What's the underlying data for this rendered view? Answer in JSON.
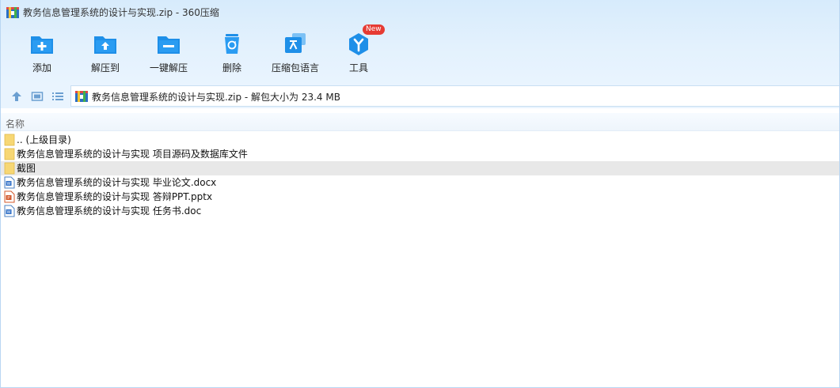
{
  "window": {
    "title": "教务信息管理系统的设计与实现.zip - 360压缩"
  },
  "toolbar": {
    "items": [
      {
        "id": "add",
        "label": "添加",
        "icon": "add-icon"
      },
      {
        "id": "extract-to",
        "label": "解压到",
        "icon": "extract-to-icon"
      },
      {
        "id": "one-click-extract",
        "label": "一键解压",
        "icon": "one-click-extract-icon"
      },
      {
        "id": "delete",
        "label": "删除",
        "icon": "recycle-bin-icon"
      },
      {
        "id": "language",
        "label": "压缩包语言",
        "icon": "language-icon"
      },
      {
        "id": "tools",
        "label": "工具",
        "icon": "tools-icon",
        "badge": "New"
      }
    ]
  },
  "nav": {
    "address": "教务信息管理系统的设计与实现.zip - 解包大小为 23.4 MB"
  },
  "list": {
    "header": "名称",
    "rows": [
      {
        "name": ".. (上级目录)",
        "type": "folder"
      },
      {
        "name": "教务信息管理系统的设计与实现 项目源码及数据库文件",
        "type": "folder"
      },
      {
        "name": "截图",
        "type": "folder",
        "selected": true
      },
      {
        "name": "教务信息管理系统的设计与实现 毕业论文.docx",
        "type": "word"
      },
      {
        "name": "教务信息管理系统的设计与实现 答辩PPT.pptx",
        "type": "ppt"
      },
      {
        "name": "教务信息管理系统的设计与实现 任务书.doc",
        "type": "word"
      }
    ]
  },
  "colors": {
    "toolbar_blue": "#1e8fe8",
    "folder_yellow": "#f7d774",
    "new_badge_red": "#e63b33"
  }
}
